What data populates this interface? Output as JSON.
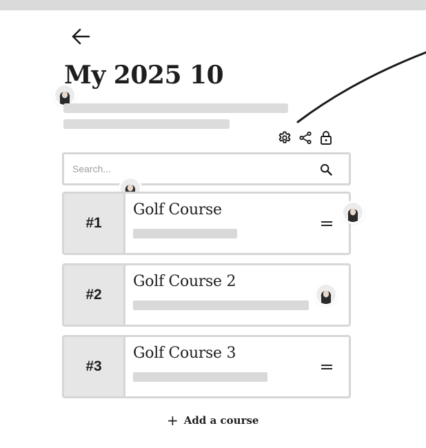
{
  "page": {
    "title": "My 2025 10",
    "back_icon": "arrow-left-icon"
  },
  "toolbar": {
    "icons": [
      "gear-icon",
      "share-icon",
      "lock-icon"
    ]
  },
  "search": {
    "placeholder": "Search...",
    "value": "",
    "icon": "search-icon"
  },
  "courses": [
    {
      "rank": "#1",
      "name": "Golf Course"
    },
    {
      "rank": "#2",
      "name": "Golf Course 2"
    },
    {
      "rank": "#3",
      "name": "Golf Course 3"
    }
  ],
  "add_course": {
    "icon": "plus-icon",
    "label": "Add a course"
  },
  "colors": {
    "background": "#ffffff",
    "skeleton": "#d9d9d9",
    "rank_cell": "#e6e6e6",
    "border": "#d6d6d6",
    "text": "#1e1e1e",
    "top_bar": "#dadada"
  }
}
